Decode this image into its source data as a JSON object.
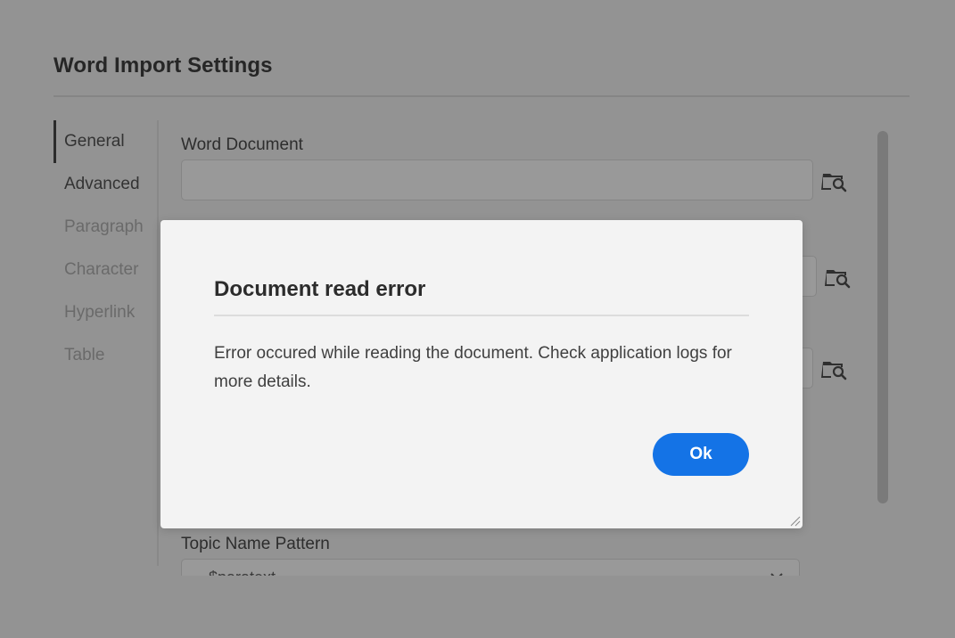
{
  "settings": {
    "title": "Word Import Settings",
    "nav": [
      {
        "label": "General",
        "state": "active"
      },
      {
        "label": "Advanced",
        "state": "normal"
      },
      {
        "label": "Paragraph",
        "state": "disabled"
      },
      {
        "label": "Character",
        "state": "disabled"
      },
      {
        "label": "Hyperlink",
        "state": "disabled"
      },
      {
        "label": "Table",
        "state": "disabled"
      }
    ],
    "word_document_label": "Word Document",
    "word_document_value": "",
    "topic_name_pattern_label": "Topic Name Pattern",
    "topic_name_pattern_value": "$paratext"
  },
  "modal": {
    "title": "Document read error",
    "message": "Error occured while reading the document. Check application logs for more details.",
    "ok_label": "Ok"
  },
  "colors": {
    "accent": "#1473e6",
    "overlay": "#939393",
    "modal_bg": "#f3f3f3"
  },
  "icons": {
    "browse": "folder-search-icon",
    "select": "chevron-down-icon",
    "resize": "resize-grip-icon"
  }
}
